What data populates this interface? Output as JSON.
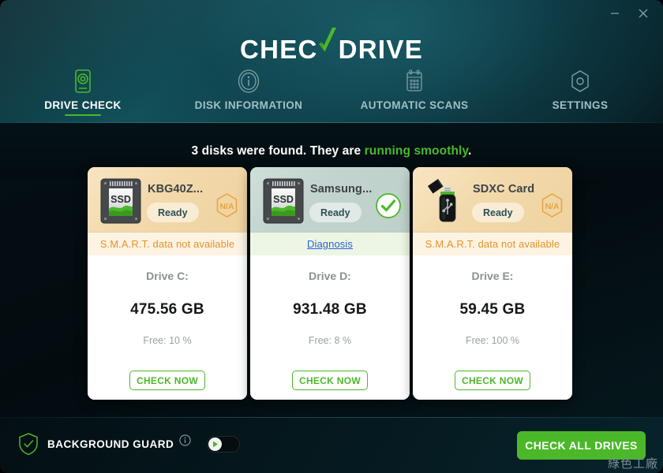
{
  "window": {
    "minimize_icon": "minimize-icon",
    "close_icon": "close-icon"
  },
  "brand": {
    "word1": "CHEC",
    "check_icon": "checkmark-k-icon",
    "word2": "DRIVE",
    "accent_green": "#4bb82a"
  },
  "nav": {
    "items": [
      {
        "label": "DRIVE CHECK",
        "icon": "hard-drive-icon",
        "active": true
      },
      {
        "label": "DISK INFORMATION",
        "icon": "info-circle-icon",
        "active": false
      },
      {
        "label": "AUTOMATIC SCANS",
        "icon": "calendar-icon",
        "active": false
      },
      {
        "label": "SETTINGS",
        "icon": "hex-nut-icon",
        "active": false
      }
    ]
  },
  "status": {
    "prefix": "3 disks were found. They are ",
    "highlight": "running smoothly",
    "suffix": ".",
    "disk_count": 3,
    "highlight_color": "#4bb82a"
  },
  "cards": [
    {
      "title": "KBG40Z...",
      "device_icon": "ssd-drive-icon",
      "state_label": "Ready",
      "badge": {
        "type": "na",
        "label": "N/A",
        "color": "#e8a33b"
      },
      "smart_text": "S.M.A.R.T. data not available",
      "smart_theme": "amber",
      "drive_letter": "Drive C:",
      "capacity": "475.56 GB",
      "free": "Free: 10 %",
      "free_percent": 10,
      "button_label": "CHECK NOW"
    },
    {
      "title": "Samsung...",
      "device_icon": "ssd-drive-icon",
      "state_label": "Ready",
      "badge": {
        "type": "ok",
        "label": "",
        "color": "#4bb82a"
      },
      "smart_text": "Diagnosis",
      "smart_theme": "green",
      "drive_letter": "Drive D:",
      "capacity": "931.48 GB",
      "free": "Free: 8 %",
      "free_percent": 8,
      "button_label": "CHECK NOW"
    },
    {
      "title": "SDXC Card",
      "device_icon": "usb-flash-drive-icon",
      "state_label": "Ready",
      "badge": {
        "type": "na",
        "label": "N/A",
        "color": "#e8a33b"
      },
      "smart_text": "S.M.A.R.T. data not available",
      "smart_theme": "amber",
      "drive_letter": "Drive E:",
      "capacity": "59.45 GB",
      "free": "Free: 100 %",
      "free_percent": 100,
      "button_label": "CHECK NOW"
    }
  ],
  "footer": {
    "shield_icon": "shield-check-icon",
    "guard_label": "BACKGROUND GUARD",
    "info_icon": "info-icon",
    "toggle": {
      "name": "background-guard-toggle",
      "state": "off",
      "knob_icon": "play-icon"
    },
    "check_all_label": "CHECK ALL DRIVES",
    "watermark": "綠色工廠"
  }
}
